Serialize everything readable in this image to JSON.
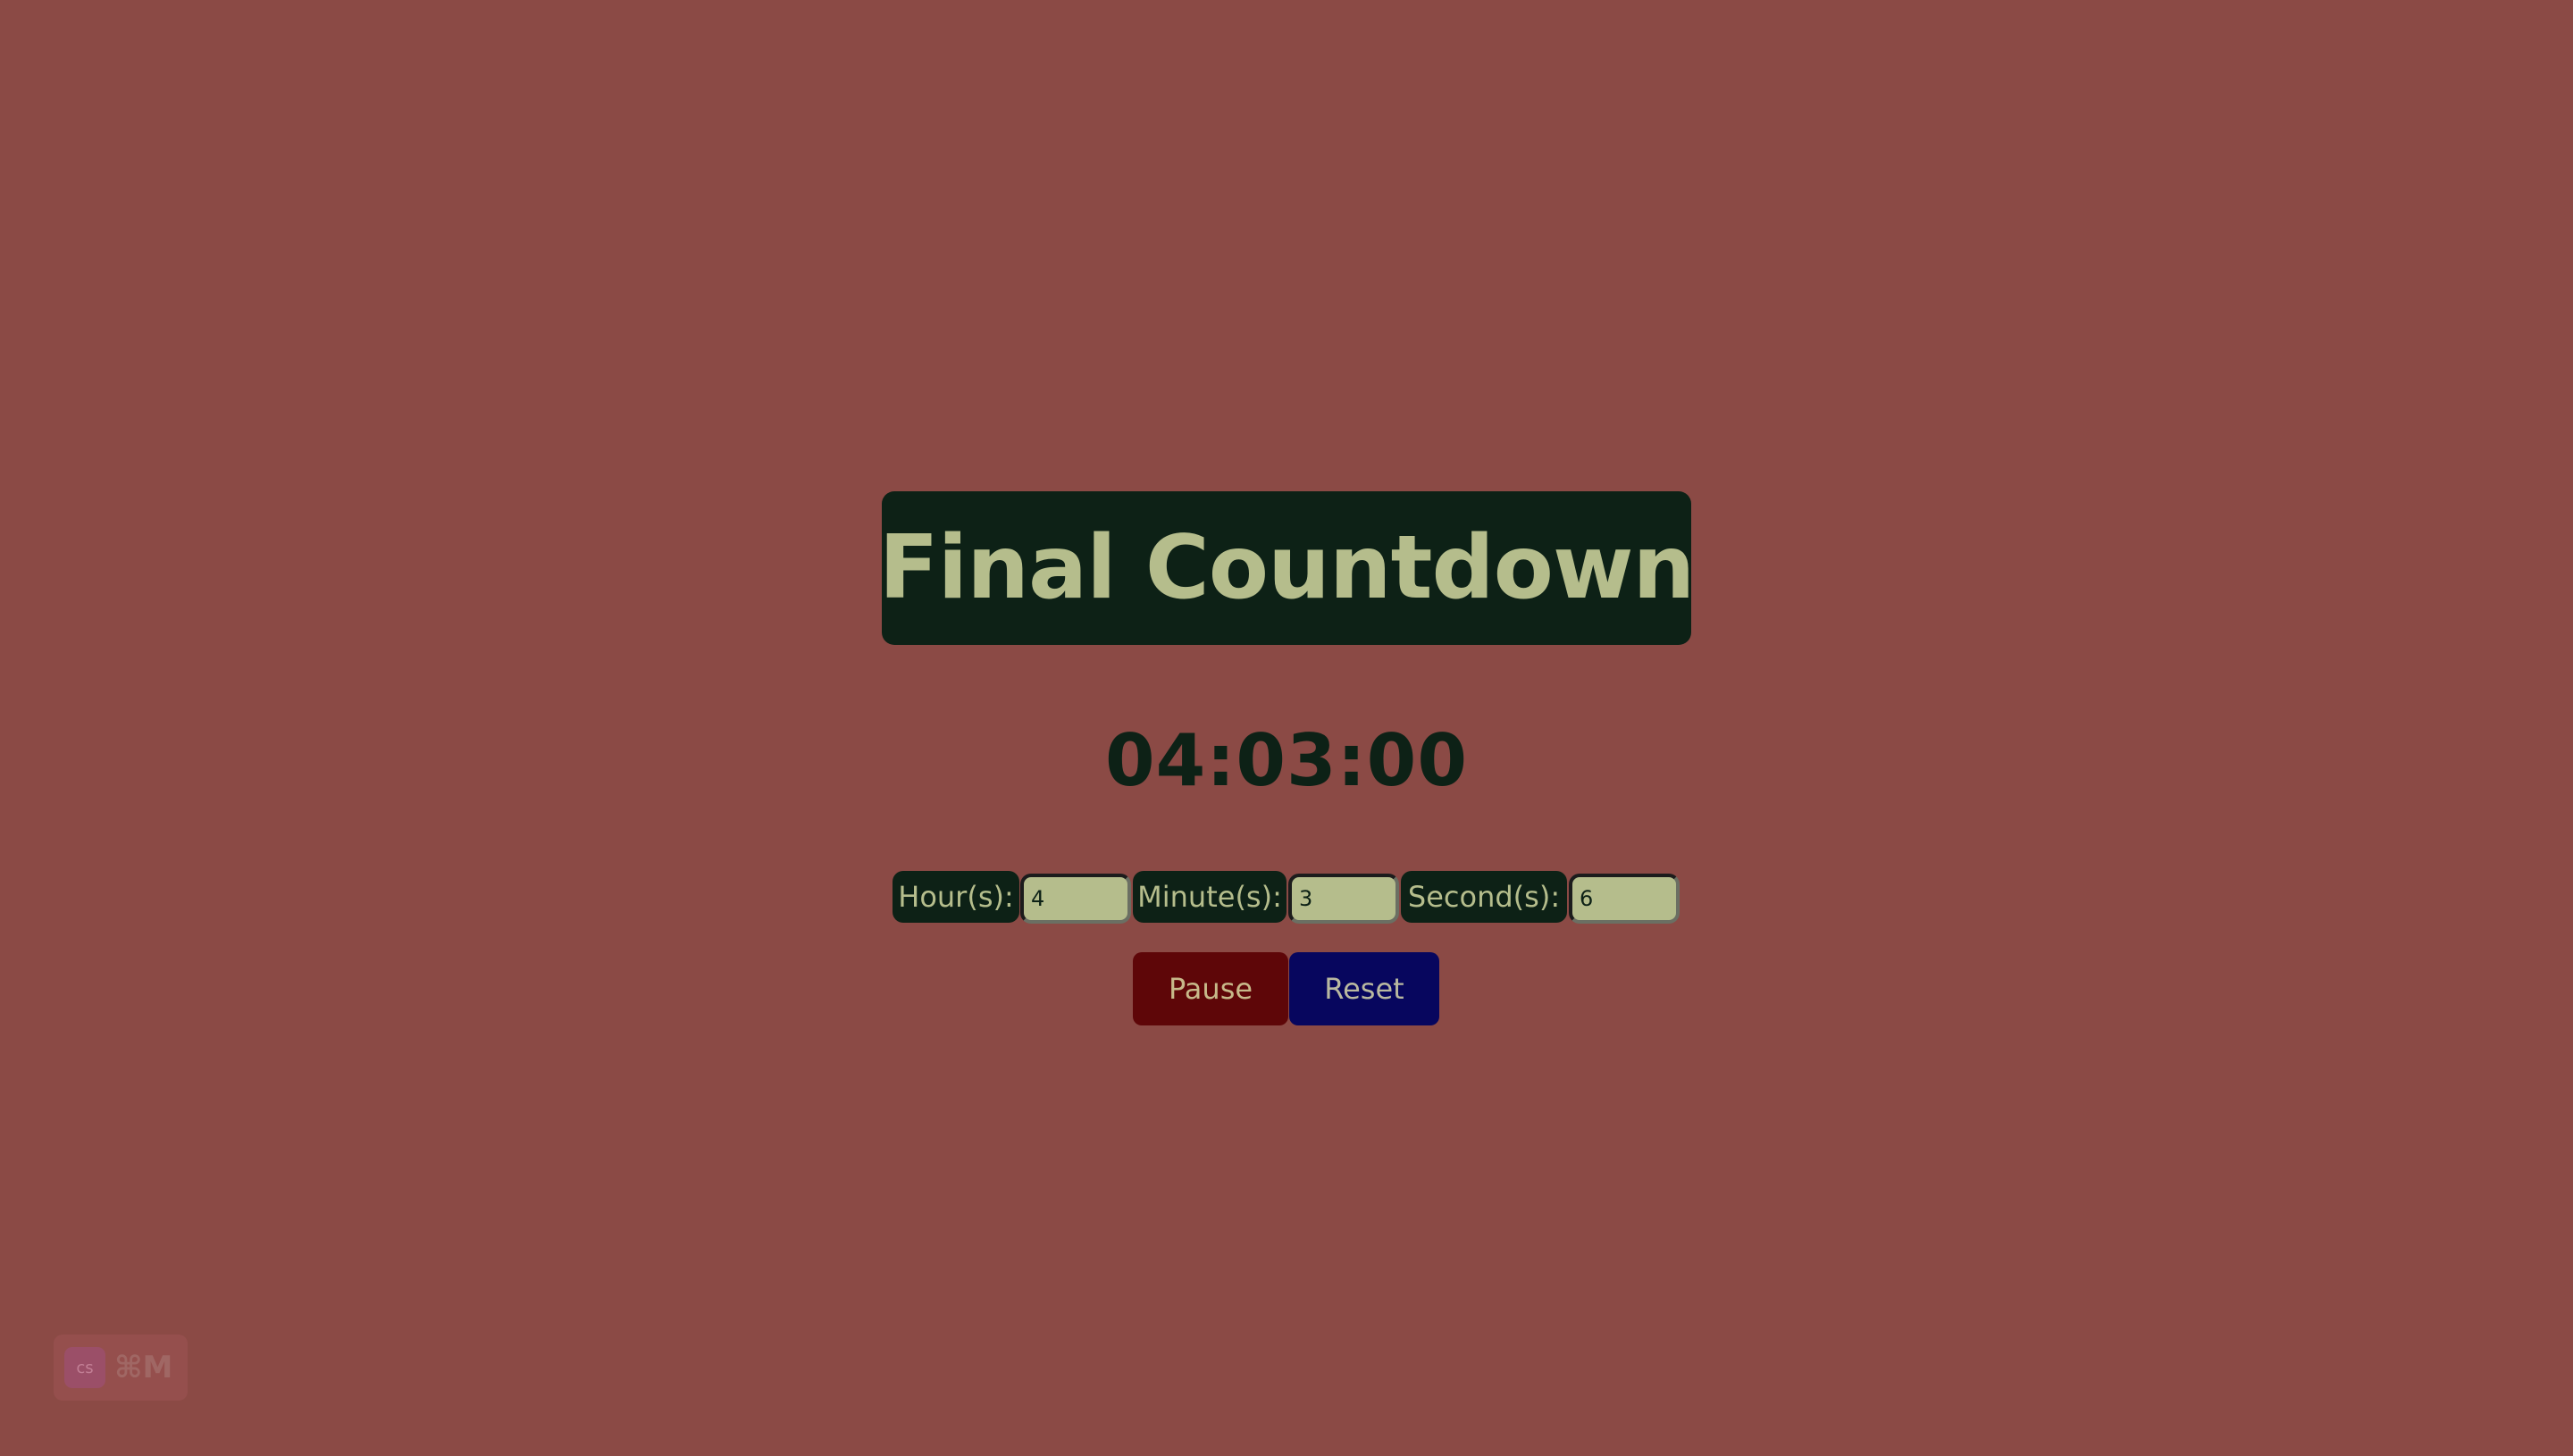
{
  "page": {
    "title": "Final Countdown",
    "timer_display": "04:03:00"
  },
  "inputs": {
    "hours": {
      "label": "Hour(s):",
      "value": "4"
    },
    "minutes": {
      "label": "Minute(s):",
      "value": "3"
    },
    "seconds": {
      "label": "Second(s):",
      "value": "6"
    }
  },
  "buttons": {
    "pause_label": "Pause",
    "reset_label": "Reset"
  },
  "badge": {
    "logo_text": "cs",
    "shortcut": "⌘M"
  },
  "colors": {
    "background": "#8b4a45",
    "panel": "#0d2116",
    "text_accent": "#b5bd8c",
    "pause_button": "#5e0608",
    "reset_button": "#07065e"
  }
}
